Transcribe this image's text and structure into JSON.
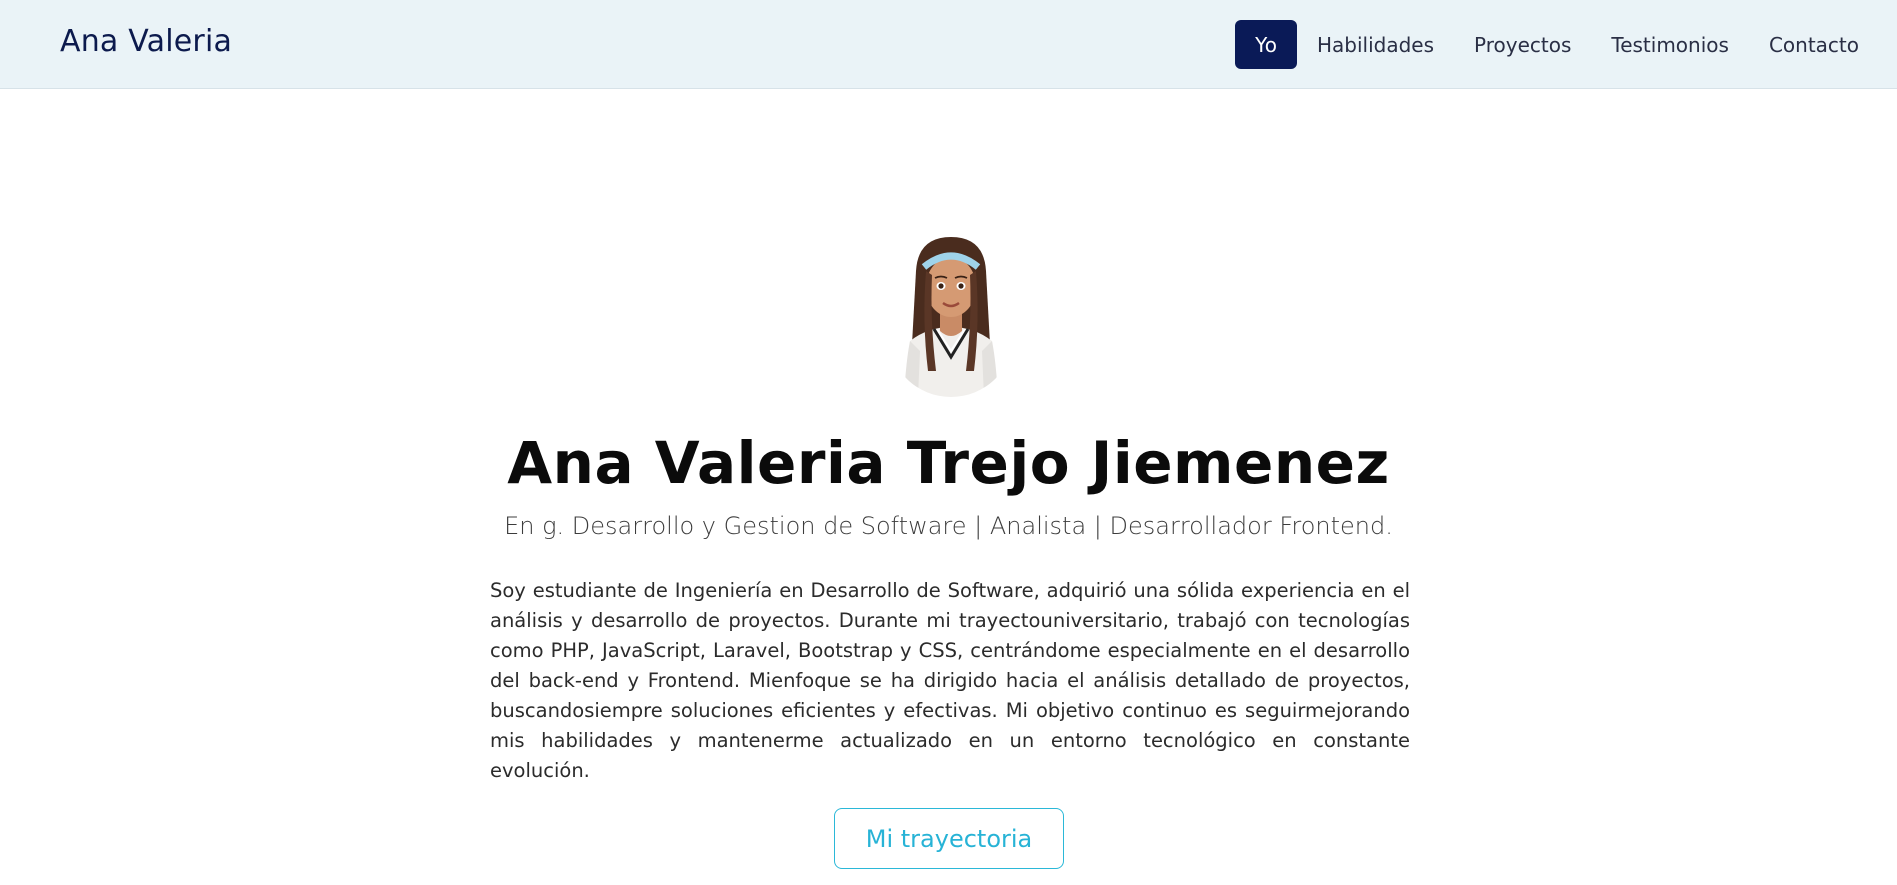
{
  "brand": "Ana Valeria",
  "nav": {
    "items": [
      {
        "label": "Yo",
        "active": true
      },
      {
        "label": "Habilidades",
        "active": false
      },
      {
        "label": "Proyectos",
        "active": false
      },
      {
        "label": "Testimonios",
        "active": false
      },
      {
        "label": "Contacto",
        "active": false
      }
    ]
  },
  "hero": {
    "avatar": "avatar-image",
    "name": "Ana Valeria Trejo Jiemenez",
    "subtitle": "En g. Desarrollo y Gestion de Software | Analista | Desarrollador Frontend.",
    "bio": "Soy estudiante de Ingeniería en Desarrollo de Software, adquirió una sólida experiencia en el análisis y desarrollo de proyectos. Durante mi trayectouniversitario, trabajó con tecnologías como PHP, JavaScript, Laravel, Bootstrap y CSS, centrándome especialmente en el desarrollo del back-end y Frontend. Mienfoque se ha dirigido hacia el análisis detallado de proyectos, buscandosiempre soluciones eficientes y efectivas. Mi objetivo continuo es seguirmejorando mis habilidades y mantenerme actualizado en un entorno tecnológico en constante evolución.",
    "cta_label": "Mi trayectoria"
  },
  "colors": {
    "navbar_bg": "#eaf3f7",
    "active_nav_bg": "#0a1a57",
    "brand_text": "#0c1a4d",
    "cta_accent": "#27b3d6"
  }
}
